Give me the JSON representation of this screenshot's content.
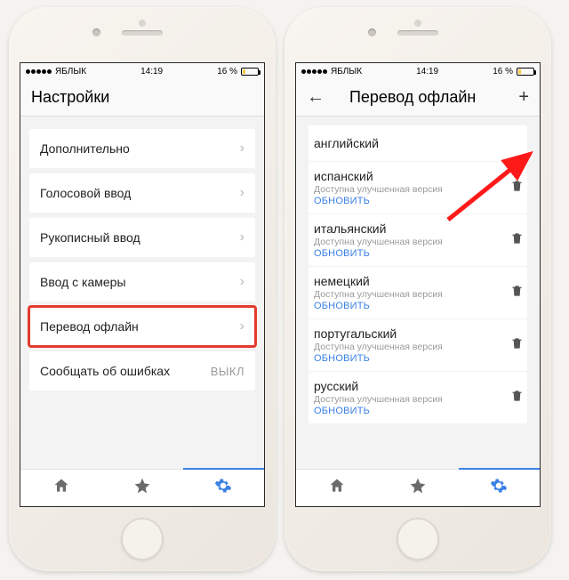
{
  "status": {
    "carrier": "ЯБЛЫК",
    "time": "14:19",
    "battery_pct": "16 %"
  },
  "left": {
    "title": "Настройки",
    "rows": {
      "extra": "Дополнительно",
      "voice": "Голосовой ввод",
      "hand": "Рукописный ввод",
      "camera": "Ввод с камеры",
      "offline": "Перевод офлайн",
      "report": "Сообщать об ошибках",
      "report_state": "ВЫКЛ"
    }
  },
  "right": {
    "title": "Перевод офлайн",
    "langs": {
      "en": {
        "name": "английский"
      },
      "es": {
        "name": "испанский",
        "sub": "Доступна улучшенная версия",
        "action": "ОБНОВИТЬ"
      },
      "it": {
        "name": "итальянский",
        "sub": "Доступна улучшенная версия",
        "action": "ОБНОВИТЬ"
      },
      "de": {
        "name": "немецкий",
        "sub": "Доступна улучшенная версия",
        "action": "ОБНОВИТЬ"
      },
      "pt": {
        "name": "португальский",
        "sub": "Доступна улучшенная версия",
        "action": "ОБНОВИТЬ"
      },
      "ru": {
        "name": "русский",
        "sub": "Доступна улучшенная версия",
        "action": "ОБНОВИТЬ"
      }
    }
  }
}
